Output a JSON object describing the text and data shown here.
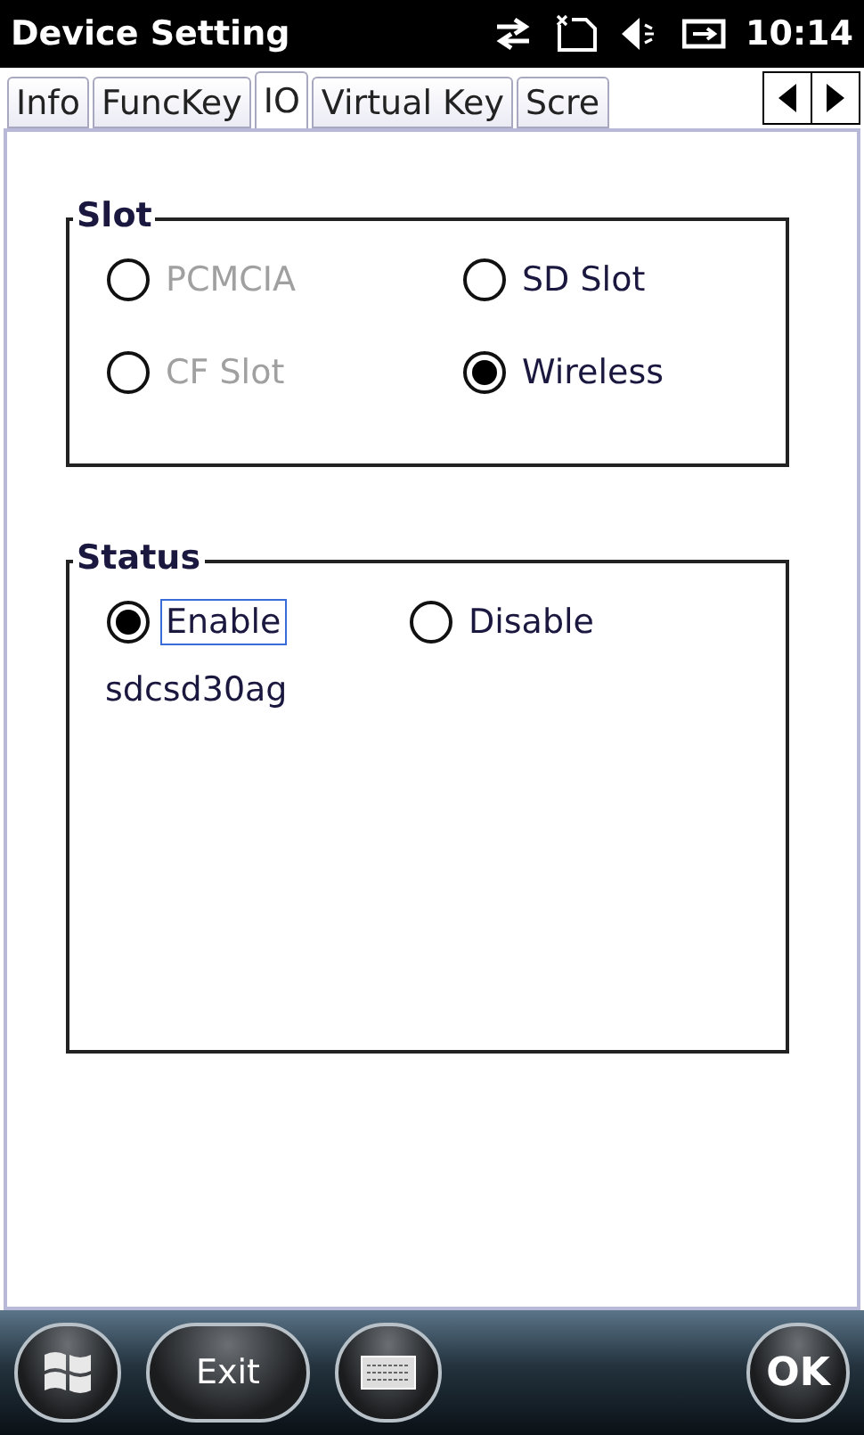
{
  "title_bar": {
    "title": "Device Setting",
    "time": "10:14"
  },
  "tabs": [
    {
      "label": "Info",
      "selected": false
    },
    {
      "label": "FuncKey",
      "selected": false
    },
    {
      "label": "IO",
      "selected": true
    },
    {
      "label": "Virtual Key",
      "selected": false
    },
    {
      "label": "Scre",
      "selected": false
    }
  ],
  "slot_group": {
    "title": "Slot",
    "options": [
      {
        "label": "PCMCIA",
        "selected": false,
        "disabled": true
      },
      {
        "label": "SD Slot",
        "selected": false,
        "disabled": false
      },
      {
        "label": "CF Slot",
        "selected": false,
        "disabled": true
      },
      {
        "label": "Wireless",
        "selected": true,
        "disabled": false
      }
    ]
  },
  "status_group": {
    "title": "Status",
    "options": [
      {
        "label": "Enable",
        "selected": true,
        "focused": true
      },
      {
        "label": "Disable",
        "selected": false,
        "focused": false
      }
    ],
    "device_name": "sdcsd30ag"
  },
  "bottom_bar": {
    "exit_label": "Exit",
    "ok_label": "OK"
  }
}
